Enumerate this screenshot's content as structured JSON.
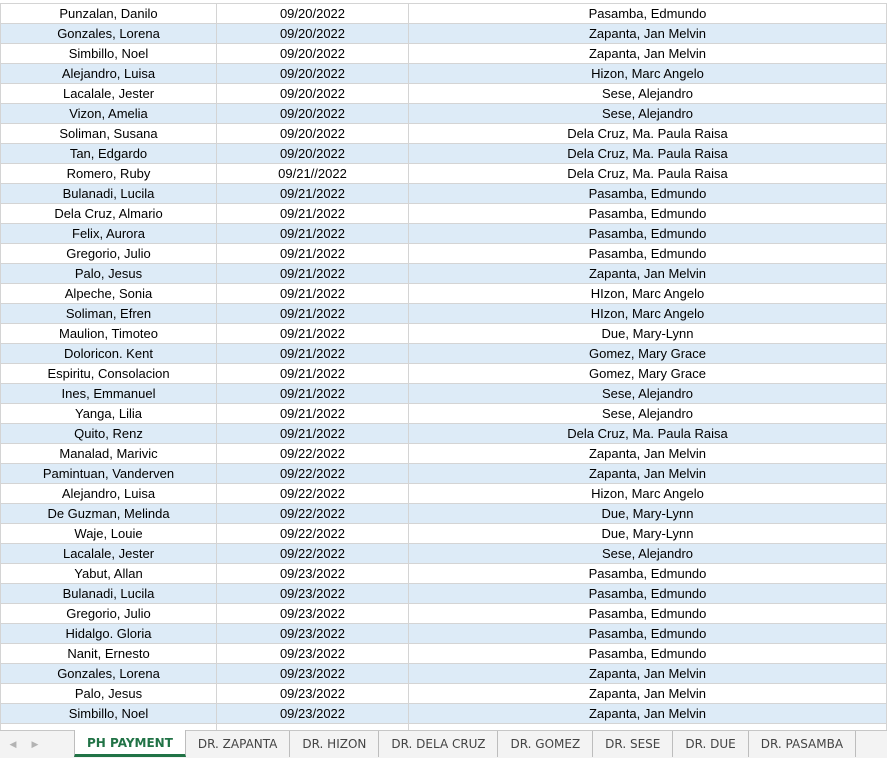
{
  "rows": [
    [
      "Punzalan, Danilo",
      "09/20/2022",
      "Pasamba, Edmundo"
    ],
    [
      "Gonzales, Lorena",
      "09/20/2022",
      "Zapanta, Jan Melvin"
    ],
    [
      "Simbillo, Noel",
      "09/20/2022",
      "Zapanta, Jan Melvin"
    ],
    [
      "Alejandro, Luisa",
      "09/20/2022",
      "Hizon, Marc Angelo"
    ],
    [
      "Lacalale, Jester",
      "09/20/2022",
      "Sese, Alejandro"
    ],
    [
      "Vizon, Amelia",
      "09/20/2022",
      "Sese, Alejandro"
    ],
    [
      "Soliman, Susana",
      "09/20/2022",
      "Dela Cruz, Ma. Paula Raisa"
    ],
    [
      "Tan, Edgardo",
      "09/20/2022",
      "Dela Cruz, Ma. Paula Raisa"
    ],
    [
      "Romero, Ruby",
      "09/21//2022",
      "Dela Cruz, Ma. Paula Raisa"
    ],
    [
      "Bulanadi, Lucila",
      "09/21/2022",
      "Pasamba, Edmundo"
    ],
    [
      "Dela Cruz, Almario",
      "09/21/2022",
      "Pasamba, Edmundo"
    ],
    [
      "Felix, Aurora",
      "09/21/2022",
      "Pasamba, Edmundo"
    ],
    [
      "Gregorio, Julio",
      "09/21/2022",
      "Pasamba, Edmundo"
    ],
    [
      "Palo, Jesus",
      "09/21/2022",
      "Zapanta, Jan Melvin"
    ],
    [
      "Alpeche, Sonia",
      "09/21/2022",
      "HIzon, Marc Angelo"
    ],
    [
      "Soliman, Efren",
      "09/21/2022",
      "HIzon, Marc Angelo"
    ],
    [
      "Maulion, Timoteo",
      "09/21/2022",
      "Due, Mary-Lynn"
    ],
    [
      "Doloricon. Kent",
      "09/21/2022",
      "Gomez, Mary Grace"
    ],
    [
      "Espiritu, Consolacion",
      "09/21/2022",
      "Gomez, Mary Grace"
    ],
    [
      "Ines, Emmanuel",
      "09/21/2022",
      "Sese, Alejandro"
    ],
    [
      "Yanga, Lilia",
      "09/21/2022",
      "Sese, Alejandro"
    ],
    [
      "Quito, Renz",
      "09/21/2022",
      "Dela Cruz, Ma. Paula Raisa"
    ],
    [
      "Manalad, Marivic",
      "09/22/2022",
      "Zapanta, Jan Melvin"
    ],
    [
      "Pamintuan, Vanderven",
      "09/22/2022",
      "Zapanta, Jan Melvin"
    ],
    [
      "Alejandro, Luisa",
      "09/22/2022",
      "Hizon, Marc Angelo"
    ],
    [
      "De Guzman, Melinda",
      "09/22/2022",
      "Due, Mary-Lynn"
    ],
    [
      "Waje, Louie",
      "09/22/2022",
      "Due, Mary-Lynn"
    ],
    [
      "Lacalale, Jester",
      "09/22/2022",
      "Sese, Alejandro"
    ],
    [
      "Yabut, Allan",
      "09/23/2022",
      "Pasamba, Edmundo"
    ],
    [
      "Bulanadi, Lucila",
      "09/23/2022",
      "Pasamba, Edmundo"
    ],
    [
      "Gregorio, Julio",
      "09/23/2022",
      "Pasamba, Edmundo"
    ],
    [
      "Hidalgo. Gloria",
      "09/23/2022",
      "Pasamba, Edmundo"
    ],
    [
      "Nanit, Ernesto",
      "09/23/2022",
      "Pasamba, Edmundo"
    ],
    [
      "Gonzales, Lorena",
      "09/23/2022",
      "Zapanta, Jan Melvin"
    ],
    [
      "Palo, Jesus",
      "09/23/2022",
      "Zapanta, Jan Melvin"
    ],
    [
      "Simbillo, Noel",
      "09/23/2022",
      "Zapanta, Jan Melvin"
    ]
  ],
  "colors": {
    "band": "#ddebf7",
    "grid_line": "#d4d4d4",
    "active_tab": "#217346"
  },
  "sheet_tabs": {
    "active_index": 0,
    "labels": [
      "PH PAYMENT",
      "DR. ZAPANTA",
      "DR. HIZON",
      "DR. DELA CRUZ",
      "DR. GOMEZ",
      "DR. SESE",
      "DR. DUE",
      "DR. PASAMBA"
    ]
  },
  "icons": {
    "prev_sheet": "triangle-left-icon",
    "next_sheet": "triangle-right-icon"
  }
}
